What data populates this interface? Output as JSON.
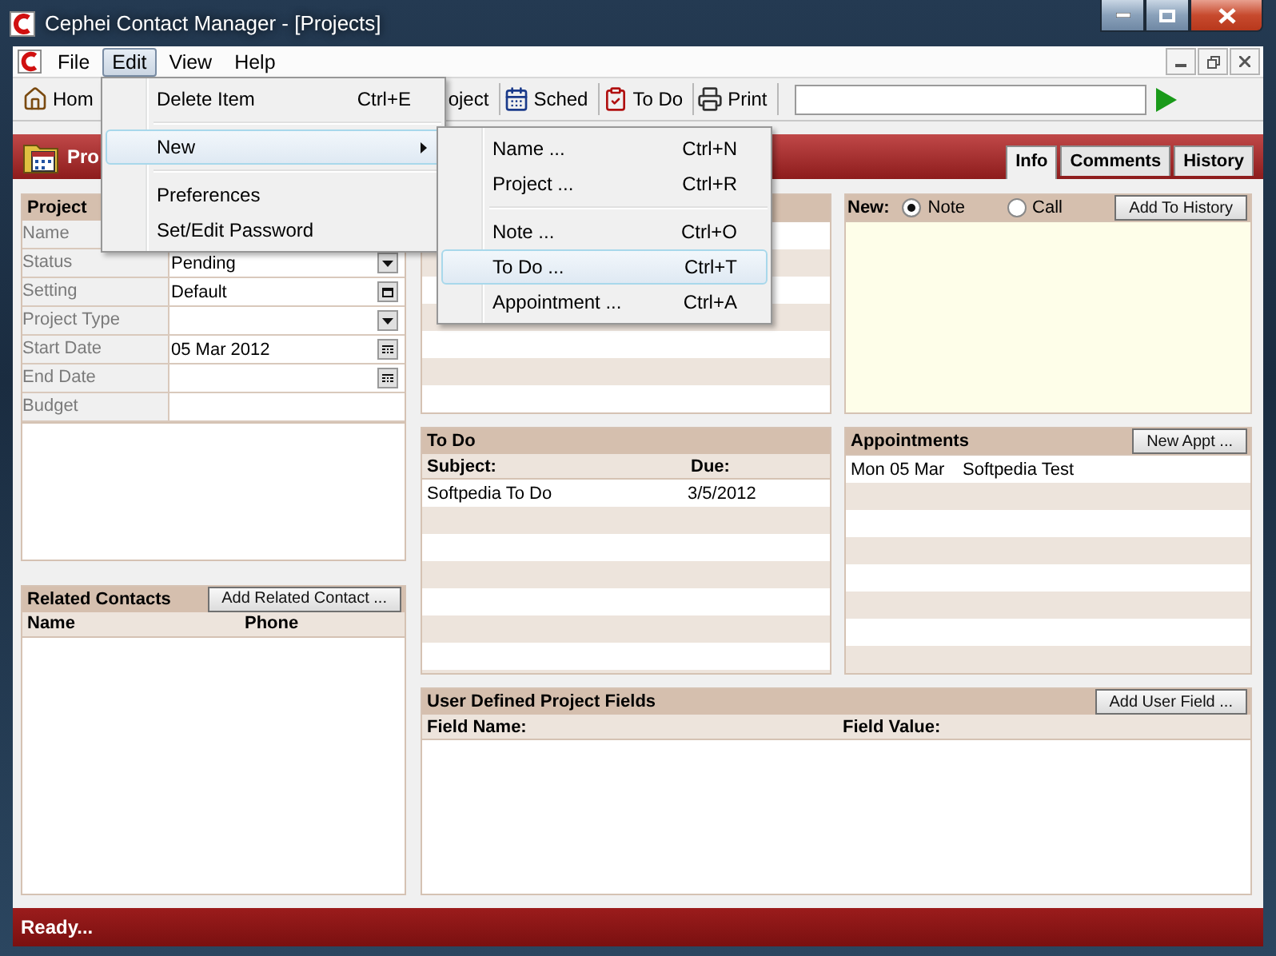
{
  "window": {
    "title": "Cephei Contact Manager - [Projects]"
  },
  "menu_bar": [
    {
      "label": "File",
      "selected": false
    },
    {
      "label": "Edit",
      "selected": true
    },
    {
      "label": "View",
      "selected": false
    },
    {
      "label": "Help",
      "selected": false
    }
  ],
  "toolbar": [
    {
      "kind": "home",
      "label": "Hom"
    },
    {
      "kind": "plain",
      "label": "oject"
    },
    {
      "kind": "schedule",
      "label": "Sched"
    },
    {
      "kind": "todo",
      "label": "To Do"
    },
    {
      "kind": "print",
      "label": "Print"
    }
  ],
  "header": {
    "title": "Pro"
  },
  "tabs": [
    {
      "label": "Info",
      "selected": true
    },
    {
      "label": "Comments",
      "selected": false
    },
    {
      "label": "History",
      "selected": false
    }
  ],
  "project_panel": {
    "title": "Project",
    "fields": [
      {
        "label": "Name",
        "kind": "text"
      },
      {
        "label": "Status",
        "value": "Pending",
        "kind": "dropdown"
      },
      {
        "label": "Setting",
        "value": "Default",
        "kind": "picker"
      },
      {
        "label": "Project Type",
        "kind": "dropdown"
      },
      {
        "label": "Start Date",
        "value": "05 Mar 2012",
        "kind": "date"
      },
      {
        "label": "End Date",
        "kind": "date"
      },
      {
        "label": "Budget",
        "kind": "text"
      }
    ]
  },
  "related_contacts": {
    "title": "Related Contacts",
    "button": "Add Related Contact ...",
    "columns": [
      "Name",
      "Phone"
    ]
  },
  "new_panel": {
    "label": "New:",
    "options": [
      {
        "label": "Note",
        "selected": true
      },
      {
        "label": "Call",
        "selected": false
      }
    ],
    "button": "Add To History"
  },
  "todo": {
    "title": "To Do",
    "columns": [
      "Subject:",
      "Due:"
    ],
    "rows": [
      [
        "Softpedia To Do",
        "3/5/2012"
      ]
    ]
  },
  "appointments": {
    "title": "Appointments",
    "button": "New Appt ...",
    "rows": [
      [
        "Mon 05 Mar",
        "Softpedia Test"
      ]
    ]
  },
  "user_fields": {
    "title": "User Defined Project Fields",
    "button": "Add User Field ...",
    "columns": [
      "Field Name:",
      "Field Value:"
    ]
  },
  "status_bar": "Ready...",
  "edit_menu": [
    {
      "kind": "item",
      "label": "Delete Item",
      "shortcut": "Ctrl+E",
      "selected": false
    },
    {
      "kind": "separator"
    },
    {
      "kind": "submenu",
      "label": "New",
      "selected": true
    },
    {
      "kind": "separator"
    },
    {
      "kind": "item",
      "label": "Preferences",
      "selected": false
    },
    {
      "kind": "item",
      "label": "Set/Edit Password",
      "selected": false
    }
  ],
  "new_submenu": [
    {
      "kind": "item",
      "label": "Name ...",
      "shortcut": "Ctrl+N",
      "selected": false
    },
    {
      "kind": "item",
      "label": "Project ...",
      "shortcut": "Ctrl+R",
      "selected": false
    },
    {
      "kind": "separator"
    },
    {
      "kind": "item",
      "label": "Note ...",
      "shortcut": "Ctrl+O",
      "selected": false
    },
    {
      "kind": "item",
      "label": "To Do ...",
      "shortcut": "Ctrl+T",
      "selected": true
    },
    {
      "kind": "item",
      "label": "Appointment ...",
      "shortcut": "Ctrl+A",
      "selected": false
    }
  ]
}
